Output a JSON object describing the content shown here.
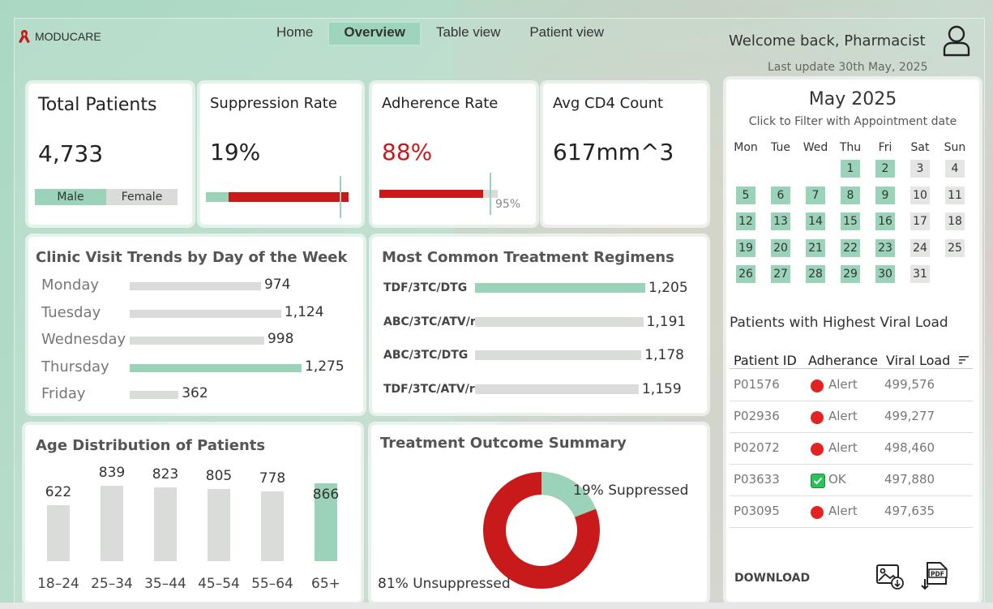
{
  "brand": {
    "name": "MODUCARE",
    "accent": "#c8191b",
    "green": "#9ad3b9"
  },
  "nav": [
    {
      "label": "Home",
      "active": false
    },
    {
      "label": "Overview",
      "active": true
    },
    {
      "label": "Table view",
      "active": false
    },
    {
      "label": "Patient view",
      "active": false
    }
  ],
  "header": {
    "welcome": "Welcome back, Pharmacist",
    "last_update": "Last update 30th May, 2025",
    "icon": "user-icon"
  },
  "kpis": {
    "total_patients": {
      "title": "Total Patients",
      "value": "4,733",
      "male_label": "Male",
      "female_label": "Female"
    },
    "suppression": {
      "title": "Suppression Rate",
      "value": "19%",
      "fraction": 0.19
    },
    "adherence": {
      "title": "Adherence Rate",
      "value": "88%",
      "fraction": 0.88,
      "target_label": "95%",
      "target": 0.95
    },
    "cd4": {
      "title": "Avg CD4 Count",
      "value": "617mm^3"
    }
  },
  "visit_trends": {
    "title": "Clinic Visit Trends by Day of the Week",
    "rows": [
      {
        "label": "Monday",
        "value": 974,
        "display": "974",
        "highlight": false
      },
      {
        "label": "Tuesday",
        "value": 1124,
        "display": "1,124",
        "highlight": false
      },
      {
        "label": "Wednesday",
        "value": 998,
        "display": "998",
        "highlight": false
      },
      {
        "label": "Thursday",
        "value": 1275,
        "display": "1,275",
        "highlight": true
      },
      {
        "label": "Friday",
        "value": 362,
        "display": "362",
        "highlight": false
      }
    ]
  },
  "regimens": {
    "title": "Most Common Treatment Regimens",
    "rows": [
      {
        "label": "TDF/3TC/DTG",
        "value": 1205,
        "display": "1,205",
        "highlight": true
      },
      {
        "label": "ABC/3TC/ATV/r",
        "value": 1191,
        "display": "1,191",
        "highlight": false
      },
      {
        "label": "ABC/3TC/DTG",
        "value": 1178,
        "display": "1,178",
        "highlight": false
      },
      {
        "label": "TDF/3TC/ATV/r",
        "value": 1159,
        "display": "1,159",
        "highlight": false
      }
    ]
  },
  "age_distribution": {
    "title": "Age Distribution of Patients",
    "categories": [
      "18–24",
      "25–34",
      "35–44",
      "45–54",
      "55–64",
      "65+"
    ],
    "values": [
      622,
      839,
      823,
      805,
      778,
      866
    ],
    "highlight_index": 5
  },
  "outcome": {
    "title": "Treatment Outcome Summary",
    "suppressed_label": "19% Suppressed",
    "unsuppressed_label": "81% Unsuppressed",
    "suppressed_fraction": 0.19,
    "colors": {
      "suppressed": "#9ad3b9",
      "unsuppressed": "#c8191b"
    }
  },
  "calendar": {
    "title": "May 2025",
    "subtitle": "Click to Filter with Appointment date",
    "weekdays": [
      "Mon",
      "Tue",
      "Wed",
      "Thu",
      "Fri",
      "Sat",
      "Sun"
    ],
    "first_weekday_index": 3,
    "days_in_month": 31,
    "appointment_days": [
      1,
      2,
      5,
      6,
      7,
      8,
      9,
      12,
      13,
      14,
      15,
      16,
      19,
      20,
      21,
      22,
      23,
      26,
      27,
      28,
      29,
      30
    ]
  },
  "viral_load": {
    "title": "Patients with Highest Viral Load",
    "columns": [
      "Patient ID",
      "Adherance",
      "Viral Load"
    ],
    "rows": [
      {
        "id": "P01576",
        "status": "Alert",
        "viral_load": "499,576"
      },
      {
        "id": "P02936",
        "status": "Alert",
        "viral_load": "499,277"
      },
      {
        "id": "P02072",
        "status": "Alert",
        "viral_load": "498,460"
      },
      {
        "id": "P03633",
        "status": "OK",
        "viral_load": "497,880"
      },
      {
        "id": "P03095",
        "status": "Alert",
        "viral_load": "497,635"
      }
    ],
    "download_label": "DOWNLOAD"
  }
}
